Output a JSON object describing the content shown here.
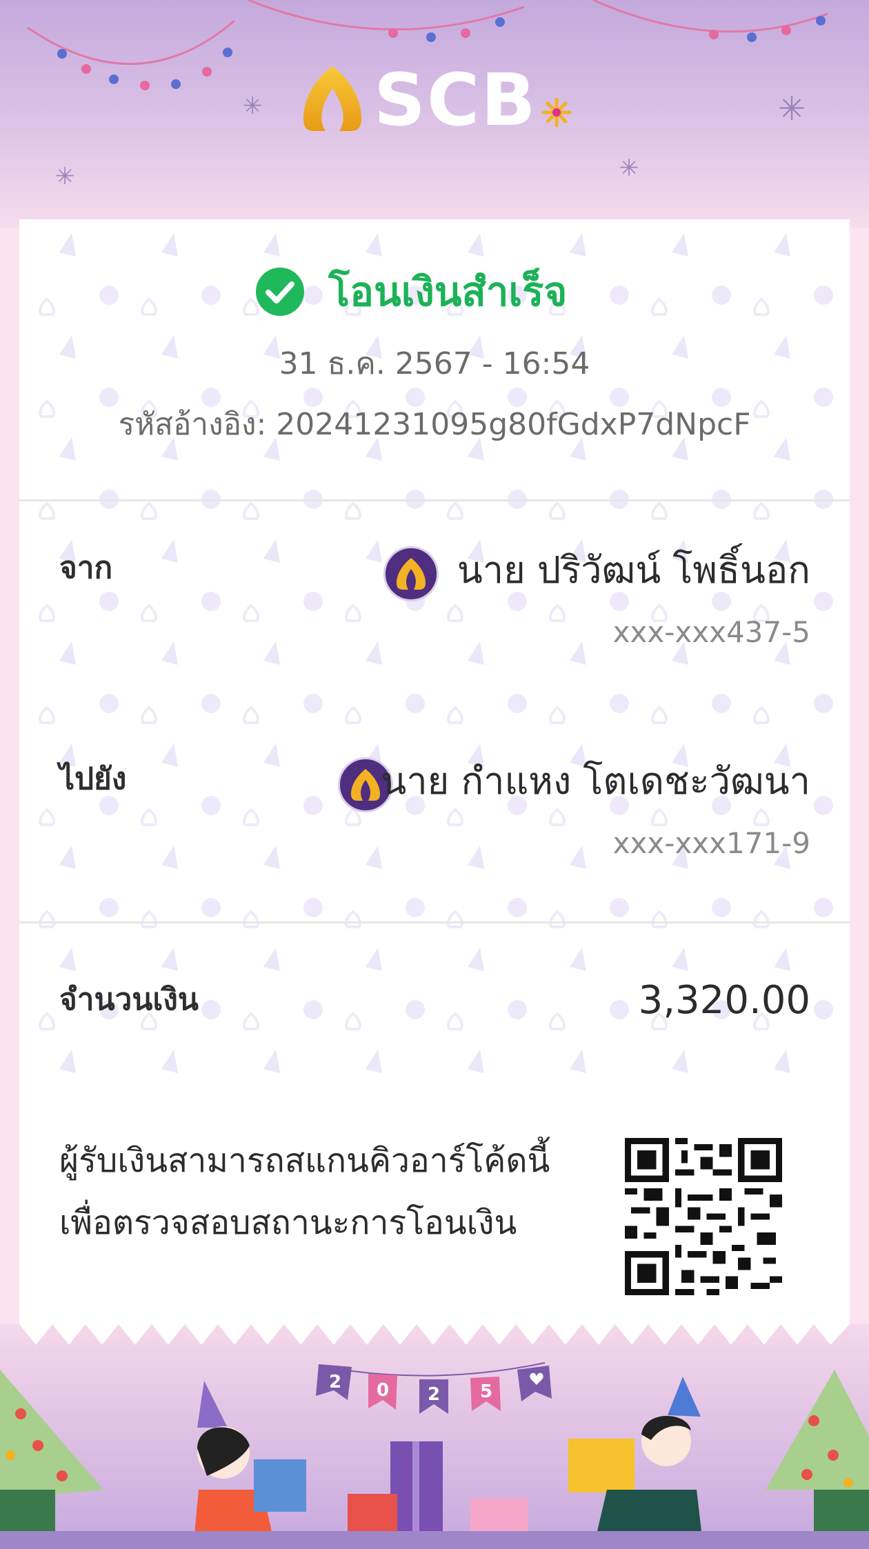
{
  "header": {
    "brand": "SCB"
  },
  "receipt": {
    "status": "โอนเงินสำเร็จ",
    "datetime": "31 ธ.ค. 2567 - 16:54",
    "reference": "รหัสอ้างอิง: 20241231095g80fGdxP7dNpcF",
    "from": {
      "label": "จาก",
      "name": "นาย ปริวัฒน์ โพธิ์นอก",
      "account": "xxx-xxx437-5"
    },
    "to": {
      "label": "ไปยัง",
      "name": "นาย กำแหง โตเดชะวัฒนา",
      "account": "xxx-xxx171-9"
    },
    "amount": {
      "label": "จำนวนเงิน",
      "value": "3,320.00"
    },
    "qr_note": {
      "line1": "ผู้รับเงินสามารถสแกนคิวอาร์โค้ดนี้",
      "line2": "เพื่อตรวจสอบสถานะการโอนเงิน"
    }
  },
  "footer": {
    "banner": [
      "2",
      "0",
      "2",
      "5"
    ]
  },
  "colors": {
    "success": "#1db158",
    "brand_purple": "#4f2d7f",
    "brand_gold": "#f2b224",
    "header_lavender": "#c4a9dc"
  }
}
